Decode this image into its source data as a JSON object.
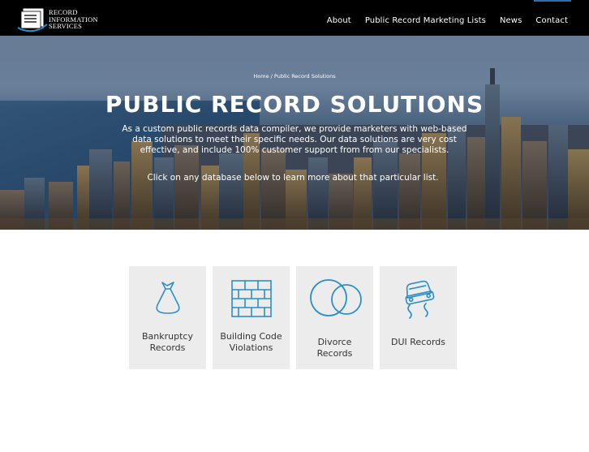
{
  "header": {
    "logo_lines": [
      "RECORD",
      "INFORMATION",
      "SERVICES"
    ],
    "nav": [
      {
        "label": "About"
      },
      {
        "label": "Public Record Marketing Lists"
      },
      {
        "label": "News"
      },
      {
        "label": "Contact"
      }
    ]
  },
  "hero": {
    "breadcrumb": "Home / Public Record Solutions",
    "title": "PUBLIC RECORD SOLUTIONS",
    "description": "As a custom public records data compiler, we provide marketers with web-based data solutions to meet their specific needs. Our data solutions are very cost effective, and include 100% customer support from from our specialists.",
    "cta": "Click on any database below to learn more about that particular list."
  },
  "cards": [
    {
      "label": "Bankruptcy Records",
      "icon": "money-bag-icon"
    },
    {
      "label": "Building Code Violations",
      "icon": "brick-wall-icon"
    },
    {
      "label": "Divorce Records",
      "icon": "rings-icon"
    },
    {
      "label": "DUI Records",
      "icon": "swerving-car-icon"
    }
  ],
  "colors": {
    "icon_stroke": "#2a8fc8",
    "card_bg": "#ececec",
    "topbar": "#000000"
  }
}
